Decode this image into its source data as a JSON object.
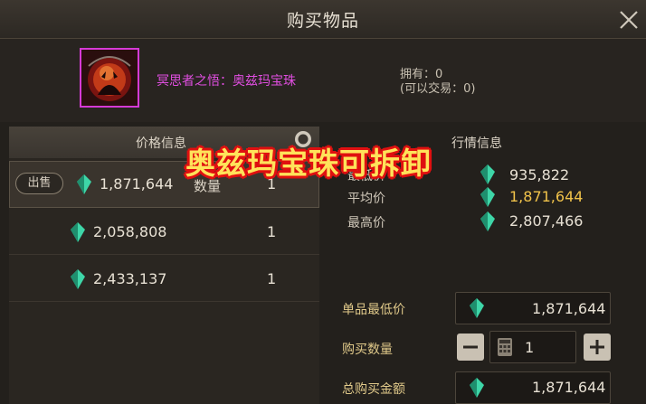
{
  "header": {
    "title": "购买物品"
  },
  "item": {
    "name": "冥思者之悟：奥兹玛宝珠",
    "owned": "拥有：0",
    "tradable": "(可以交易：0)",
    "border_color": "#d63ad6"
  },
  "price_panel": {
    "header": "价格信息",
    "sell_label": "出售",
    "qty_label": "数量",
    "rows": [
      {
        "price": "1,871,644",
        "qty": "1"
      },
      {
        "price": "2,058,808",
        "qty": "1"
      },
      {
        "price": "2,433,137",
        "qty": "1"
      }
    ]
  },
  "market_panel": {
    "header": "行情信息",
    "lowest_label": "最低价",
    "lowest": "935,822",
    "average_label": "平均价",
    "average": "1,871,644",
    "highest_label": "最高价",
    "highest": "2,807,466"
  },
  "purchase": {
    "unit_price_label": "单品最低价",
    "unit_price": "1,871,644",
    "quantity_label": "购买数量",
    "quantity": "1",
    "total_label": "总购买金额",
    "total": "1,871,644"
  },
  "overlay_text": "奥兹玛宝珠可拆卸",
  "colors": {
    "gem": "#3ed6a8",
    "average_price": "#f1c34a",
    "item_name": "#e04ee0",
    "overlay_fill": "#ffe35a",
    "overlay_outline": "#e01010"
  },
  "icons": {
    "close": "close-icon",
    "gem": "gem-currency-icon",
    "search": "search-icon",
    "calculator": "calculator-icon"
  }
}
